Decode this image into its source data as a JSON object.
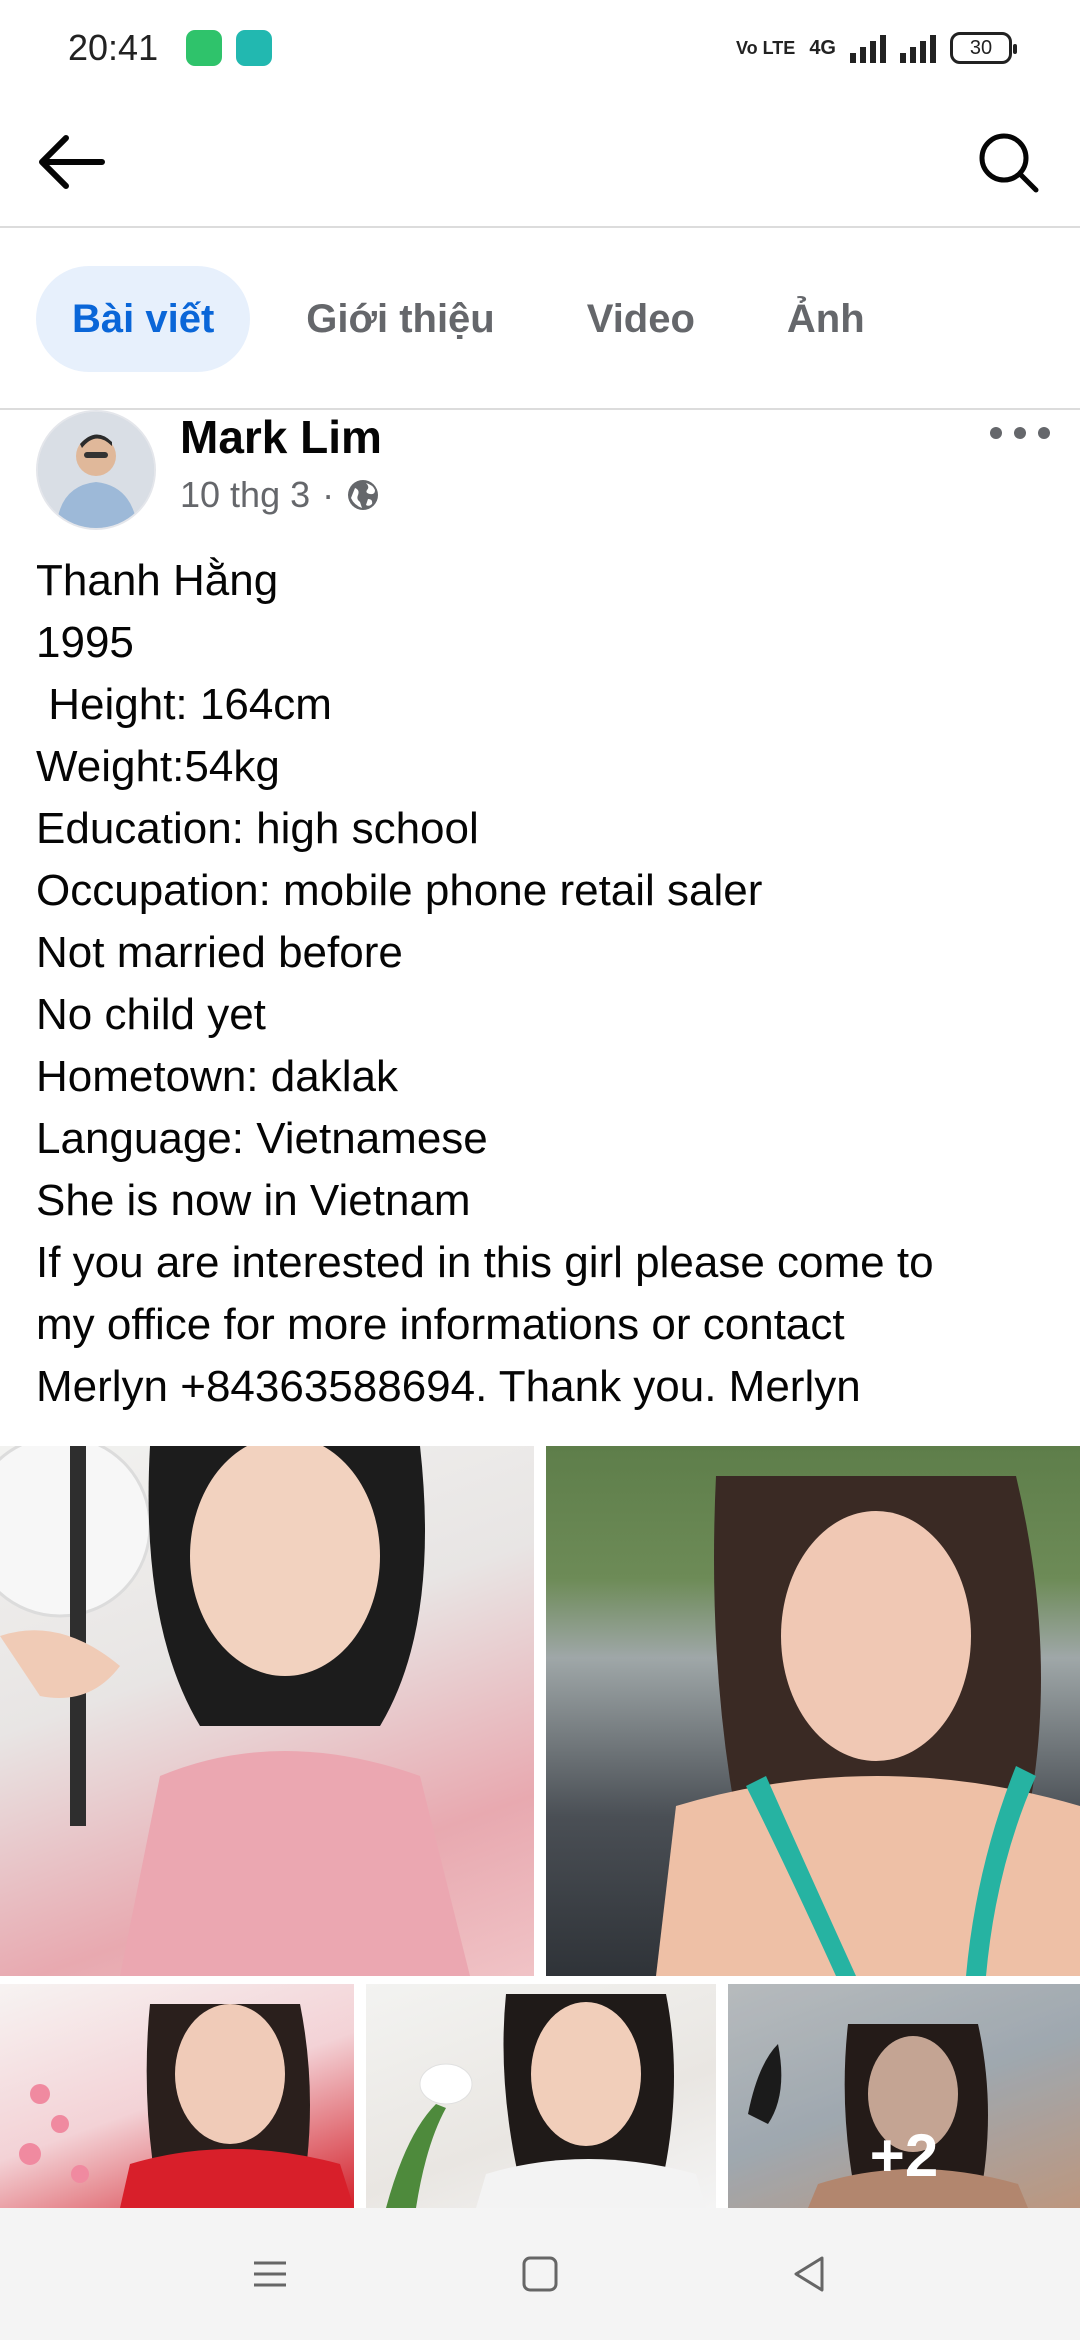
{
  "status_bar": {
    "time": "20:41",
    "network_label": "Vo LTE",
    "network_type": "4G",
    "battery": "30"
  },
  "tabs": [
    {
      "label": "Bài viết",
      "active": true
    },
    {
      "label": "Giới thiệu",
      "active": false
    },
    {
      "label": "Video",
      "active": false
    },
    {
      "label": "Ảnh",
      "active": false
    }
  ],
  "post": {
    "author": "Mark Lim",
    "date": "10 thg 3",
    "separator": "·",
    "privacy_icon": "globe-icon",
    "lines": [
      "Thanh Hằng",
      "1995",
      " Height: 164cm",
      "Weight:54kg",
      "Education: high school",
      "Occupation: mobile phone retail saler",
      "Not married before",
      "No child yet",
      "Hometown: daklak",
      "Language: Vietnamese",
      "She is now in Vietnam",
      "If you are interested in this girl please come to",
      "my office for more informations or contact",
      "Merlyn +84363588694. Thank you. Merlyn"
    ],
    "more_photos": "+2"
  },
  "colors": {
    "accent": "#0a66d8",
    "accent_bg": "#e7f0fc",
    "secondary_text": "#65676b"
  }
}
